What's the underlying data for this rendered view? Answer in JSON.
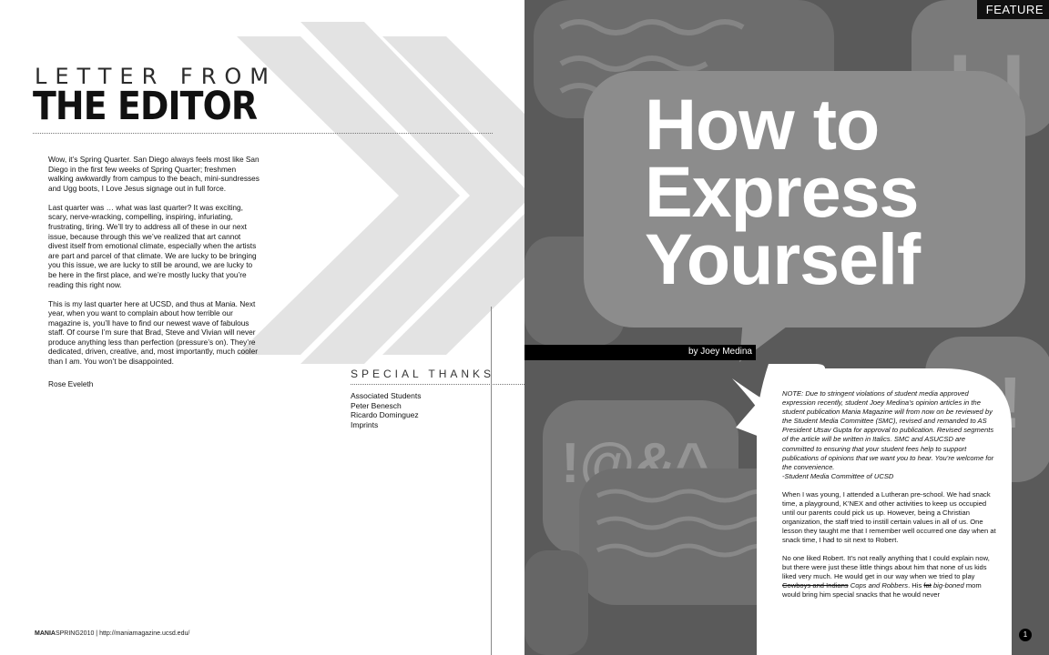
{
  "left": {
    "kicker": "LETTER FROM",
    "headline": "THE EDITOR",
    "paragraphs": [
      "Wow, it’s Spring Quarter. San Diego always feels most like San Diego in the first few weeks of Spring Quarter; freshmen walking awkwardly from campus to the beach, mini-sundresses and Ugg boots, I Love Jesus signage out in full force.",
      "Last quarter was … what was last quarter? It was exciting, scary, nerve-wracking, compelling, inspiring, infuriating, frustrating, tiring. We’ll try to address all of these in our next issue, because through this we’ve realized that art cannot divest itself from emotional climate, especially when the artists are part and parcel of that climate. We are lucky to be bringing you this issue, we are lucky to still be around, we are lucky to be here in the first place, and we’re mostly lucky that you’re reading this right now.",
      "This is my last quarter here at UCSD, and thus at Mania. Next year, when you want to complain about how terrible our magazine is, you’ll have to find our newest wave of fabulous staff. Of course I’m sure that Brad, Steve and Vivian will never produce anything less than perfection (pressure’s on). They’re dedicated, driven, creative, and, most importantly, much cooler than I am. You won’t be disappointed."
    ],
    "signature": "Rose Eveleth",
    "thanks_title": "SPECIAL THANKS",
    "thanks": [
      "Associated Students",
      "Peter Benesch",
      "Ricardo Dominguez",
      "Imprints"
    ],
    "folio_brand": "MANIA",
    "folio_rest": "SPRING2010 | http://maniamagazine.ucsd.edu/"
  },
  "right": {
    "section": "FEATURE",
    "title_lines": [
      "How to",
      "Express",
      "Yourself"
    ],
    "byline": "by Joey Medina",
    "note_lines": [
      "NOTE: Due to stringent violations of student media approved expression recently, student Joey Medina’s opinion articles in the student publication Mania Magazine will from now on be reviewed by the Student Media Committee (SMC), revised and remanded to AS President Utsav Gupta for approval to publication. Revised segments of the article will be written in Italics. SMC and ASUCSD are committed to ensuring that your student fees help to support publications of opinions that we want you to hear. You’re welcome for the convenience.",
      "-Student Media Committee of UCSD"
    ],
    "para1": "When I was young, I attended a Lutheran pre-school. We had snack time, a playground, K’NEX and other activities to keep us occupied until our parents could pick us up. However, being a Christian organization, the staff tried to instill certain values in all of us. One lesson they taught me that I remember well occurred one day when at snack time, I had to sit next to Robert.",
    "para2_a": "No one liked Robert. It’s not really anything that I could explain now, but there were just these little things about him that none of us kids liked very much. He would get in our way when we tried to play ",
    "para2_strike": "Cowboys and Indians",
    "para2_it": "Cops and Robbers",
    "para2_b": ". His ",
    "para2_strike2": "fat",
    "para2_it2": "big-boned",
    "para2_c": " mom would bring him special snacks that he would never",
    "page_number": "1"
  },
  "colors": {
    "right_bg": "#5a5a5a",
    "bubble": "#8c8c8c",
    "article_bg": "#ffffff",
    "chevron": "#e3e3e3"
  }
}
